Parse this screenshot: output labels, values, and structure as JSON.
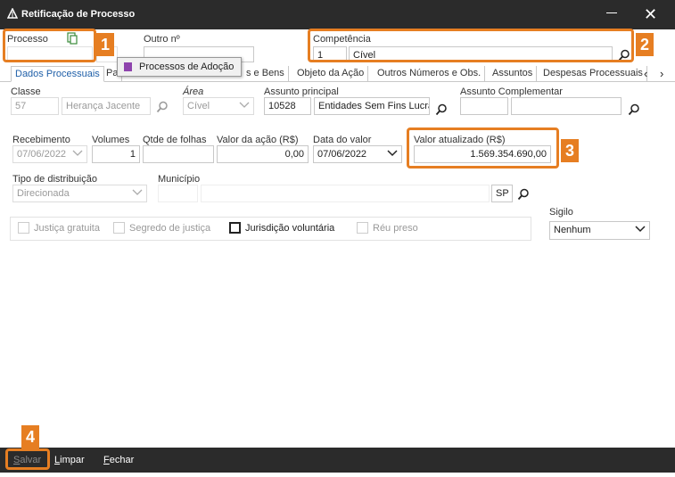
{
  "window": {
    "title": "Retificação de Processo",
    "minimize_glyph": "—",
    "close_glyph": "✕"
  },
  "icons": {
    "app": "app-triangle-icon",
    "search": "search-icon",
    "copy": "copy-document-icon",
    "chevron": "chevron-down-icon"
  },
  "header": {
    "processo_label": "Processo",
    "outro_label": "Outro nº",
    "competencia_label": "Competência",
    "competencia_code": "1",
    "competencia_value": "Cível"
  },
  "popup": {
    "label": "Processos de Adoção"
  },
  "tabs": [
    {
      "label": "Dados Processuais"
    },
    {
      "label": "Pa"
    },
    {
      "label": "s e Bens"
    },
    {
      "label": "Objeto da Ação"
    },
    {
      "label": "Outros Números e Obs."
    },
    {
      "label": "Assuntos"
    },
    {
      "label": "Despesas Processuais"
    }
  ],
  "tab_nav": {
    "prev": "‹",
    "next": "›"
  },
  "form": {
    "classe_label": "Classe",
    "classe_code": "57",
    "classe_value": "Herança Jacente",
    "area_label": "Área",
    "area_value": "Cível",
    "assunto_label": "Assunto principal",
    "assunto_code": "10528",
    "assunto_value": "Entidades Sem Fins Lucrativos",
    "assunto_comp_label": "Assunto Complementar",
    "recebimento_label": "Recebimento",
    "recebimento_value": "07/06/2022",
    "volumes_label": "Volumes",
    "volumes_value": "1",
    "qtde_label": "Qtde de folhas",
    "valor_acao_label": "Valor da ação (R$)",
    "valor_acao_value": "0,00",
    "data_valor_label": "Data do valor",
    "data_valor_value": "07/06/2022",
    "valor_atualizado_label": "Valor atualizado (R$)",
    "valor_atualizado_value": "1.569.354.690,00",
    "tipo_dist_label": "Tipo de distribuição",
    "tipo_dist_value": "Direcionada",
    "municipio_label": "Município",
    "uf_value": "SP",
    "sigilo_label": "Sigilo",
    "sigilo_value": "Nenhum"
  },
  "checkboxes": {
    "justica_gratuita": "Justiça gratuita",
    "segredo": "Segredo de justiça",
    "jurisdicao": "Jurisdição voluntária",
    "reu_preso": "Réu preso"
  },
  "callouts": {
    "b1": "1",
    "b2": "2",
    "b3": "3",
    "b4": "4"
  },
  "footer": {
    "salvar": "Salvar",
    "limpar": "Limpar",
    "fechar": "Fechar"
  },
  "colors": {
    "highlight": "#e67e22",
    "titlebar": "#2b2b2b",
    "tab_active": "#1f5fa8",
    "popup_marker": "#8e44ad"
  }
}
